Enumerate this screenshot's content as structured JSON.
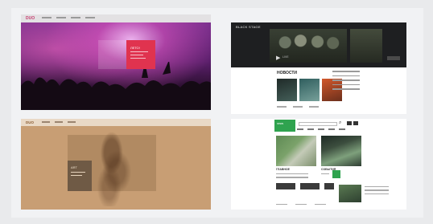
{
  "gallery": {
    "shots": [
      {
        "id": "concert",
        "logo_text": "DUO",
        "card_title": "ЛЕТО!",
        "accent_color": "#e0334f"
      },
      {
        "id": "dark-news",
        "logo_text": "BLACK STAGE",
        "heading": "НОВОСТИ",
        "hero_tag": "LIVE",
        "accent_color": "#1e1f21"
      },
      {
        "id": "sepia",
        "logo_text": "DUO",
        "card_title": "ART",
        "accent_color": "#c89e74"
      },
      {
        "id": "green-news",
        "logo_text": "news",
        "caption_1": "ГЛАВНОЕ",
        "caption_2": "СОБЫТИЯ",
        "accent_color": "#2fa34f"
      }
    ]
  }
}
